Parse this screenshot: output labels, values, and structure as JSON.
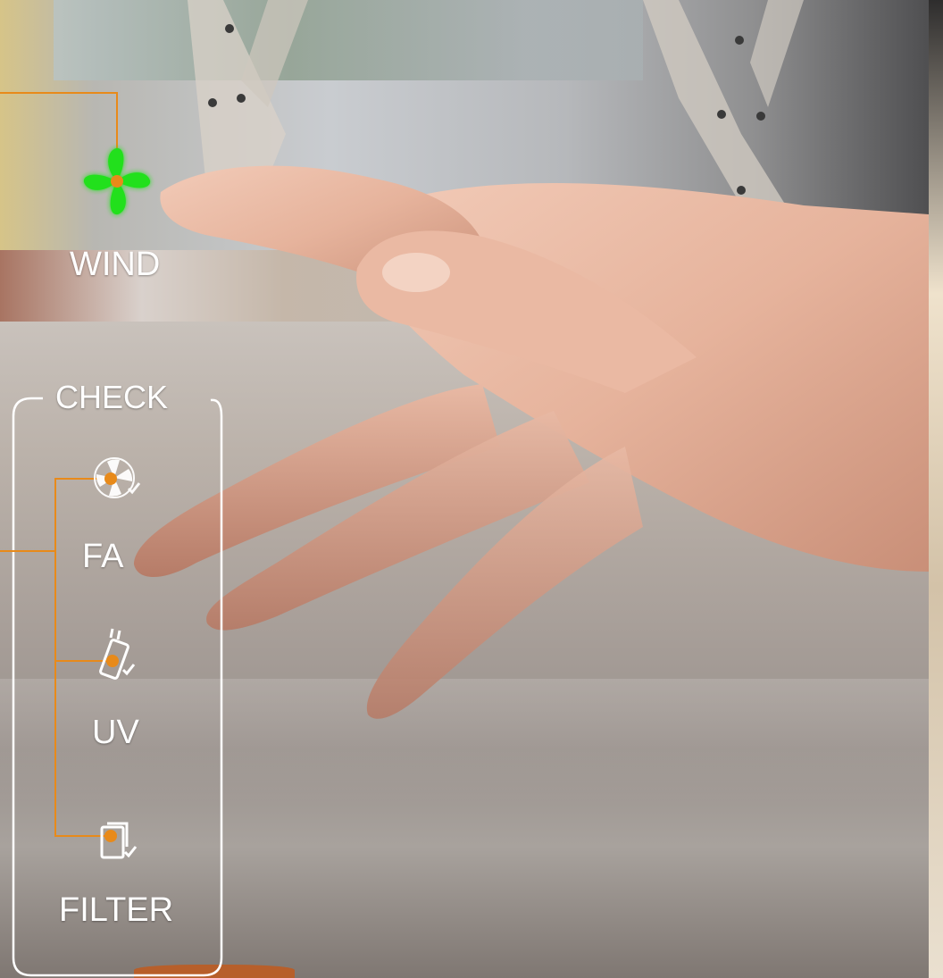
{
  "wind": {
    "label": "WIND",
    "icon": "fan-blade-icon",
    "state": "active",
    "color": "#22e01e"
  },
  "check": {
    "title": "CHECK",
    "items": [
      {
        "label": "FA",
        "icon": "fan-check-icon"
      },
      {
        "label": "UV",
        "icon": "uv-lamp-check-icon"
      },
      {
        "label": "FILTER",
        "icon": "filter-check-icon"
      }
    ]
  },
  "colors": {
    "connector": "#e88a1a",
    "outline": "#ffffff"
  }
}
